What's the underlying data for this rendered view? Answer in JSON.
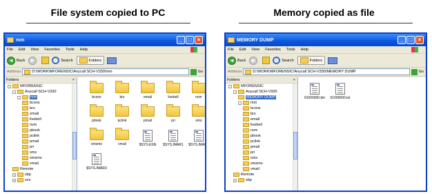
{
  "captions": {
    "left": "File system copied to PC",
    "right": "Memory copied as file"
  },
  "menu": [
    "File",
    "Edit",
    "View",
    "Favorites",
    "Tools",
    "Help"
  ],
  "toolbar": {
    "back": "Back",
    "search": "Search",
    "folders": "Folders"
  },
  "address_label": "Address",
  "go_label": "Go",
  "folders_header": "Folders",
  "left_window": {
    "title": "mm",
    "address": "D:\\WORK\\MFORENSIC\\Anycall SCH-V330\\mm",
    "tree": [
      {
        "label": "MFORENSIC",
        "indent": 0,
        "toggle": "-"
      },
      {
        "label": "Anycall SCH-V330",
        "indent": 1,
        "toggle": "-"
      },
      {
        "label": "mm",
        "indent": 2,
        "toggle": "-",
        "selected": true
      },
      {
        "label": "bcons",
        "indent": 3
      },
      {
        "label": "brs",
        "indent": 3
      },
      {
        "label": "email",
        "indent": 3
      },
      {
        "label": "livebell",
        "indent": 3
      },
      {
        "label": "nvm",
        "indent": 3
      },
      {
        "label": "pbook",
        "indent": 3
      },
      {
        "label": "pclink",
        "indent": 3
      },
      {
        "label": "pmail",
        "indent": 3
      },
      {
        "label": "pri",
        "indent": 3
      },
      {
        "label": "sms",
        "indent": 3
      },
      {
        "label": "smsmo",
        "indent": 3
      },
      {
        "label": "vmail",
        "indent": 3
      },
      {
        "label": "Remote",
        "indent": 1
      },
      {
        "label": "sbp",
        "indent": 1,
        "toggle": "+"
      },
      {
        "label": "sce",
        "indent": 1,
        "toggle": "+"
      }
    ],
    "items": [
      {
        "label": "bcons",
        "type": "folder"
      },
      {
        "label": "brs",
        "type": "folder"
      },
      {
        "label": "email",
        "type": "folder"
      },
      {
        "label": "livebell",
        "type": "folder"
      },
      {
        "label": "nvm",
        "type": "folder"
      },
      {
        "label": "pbook",
        "type": "folder"
      },
      {
        "label": "pclink",
        "type": "folder"
      },
      {
        "label": "pmail",
        "type": "folder"
      },
      {
        "label": "pri",
        "type": "folder"
      },
      {
        "label": "sms",
        "type": "folder"
      },
      {
        "label": "smsmo",
        "type": "folder"
      },
      {
        "label": "vmail",
        "type": "folder"
      },
      {
        "label": "$SYS.ESN",
        "type": "file"
      },
      {
        "label": "$SYS.IMAR1",
        "type": "file"
      },
      {
        "label": "$SYS.IMAR2",
        "type": "file"
      },
      {
        "label": "$SYS.IMAR3",
        "type": "file"
      }
    ]
  },
  "right_window": {
    "title": "MEMORY DUMP",
    "address": "D:\\WORK\\MFORENSIC\\Anycall SCH-V330\\MEMORY DUMP",
    "tree": [
      {
        "label": "MFORENSIC",
        "indent": 0,
        "toggle": "-"
      },
      {
        "label": "Anycall SCH-V330",
        "indent": 1,
        "toggle": "-"
      },
      {
        "label": "MEMORY DUMP",
        "indent": 2,
        "selected": true
      },
      {
        "label": "mm",
        "indent": 2,
        "toggle": "-"
      },
      {
        "label": "bcons",
        "indent": 3
      },
      {
        "label": "brs",
        "indent": 3
      },
      {
        "label": "email",
        "indent": 3
      },
      {
        "label": "livebell",
        "indent": 3
      },
      {
        "label": "nvm",
        "indent": 3
      },
      {
        "label": "pbook",
        "indent": 3
      },
      {
        "label": "pclink",
        "indent": 3
      },
      {
        "label": "pmail",
        "indent": 3
      },
      {
        "label": "pri",
        "indent": 3
      },
      {
        "label": "sms",
        "indent": 3
      },
      {
        "label": "smsmo",
        "indent": 3
      },
      {
        "label": "vmail",
        "indent": 3
      },
      {
        "label": "Remote",
        "indent": 1
      },
      {
        "label": "sbp",
        "indent": 1,
        "toggle": "+"
      }
    ],
    "items": [
      {
        "label": "01000000.bin",
        "type": "file"
      },
      {
        "label": "01000000.txt",
        "type": "file"
      }
    ]
  }
}
